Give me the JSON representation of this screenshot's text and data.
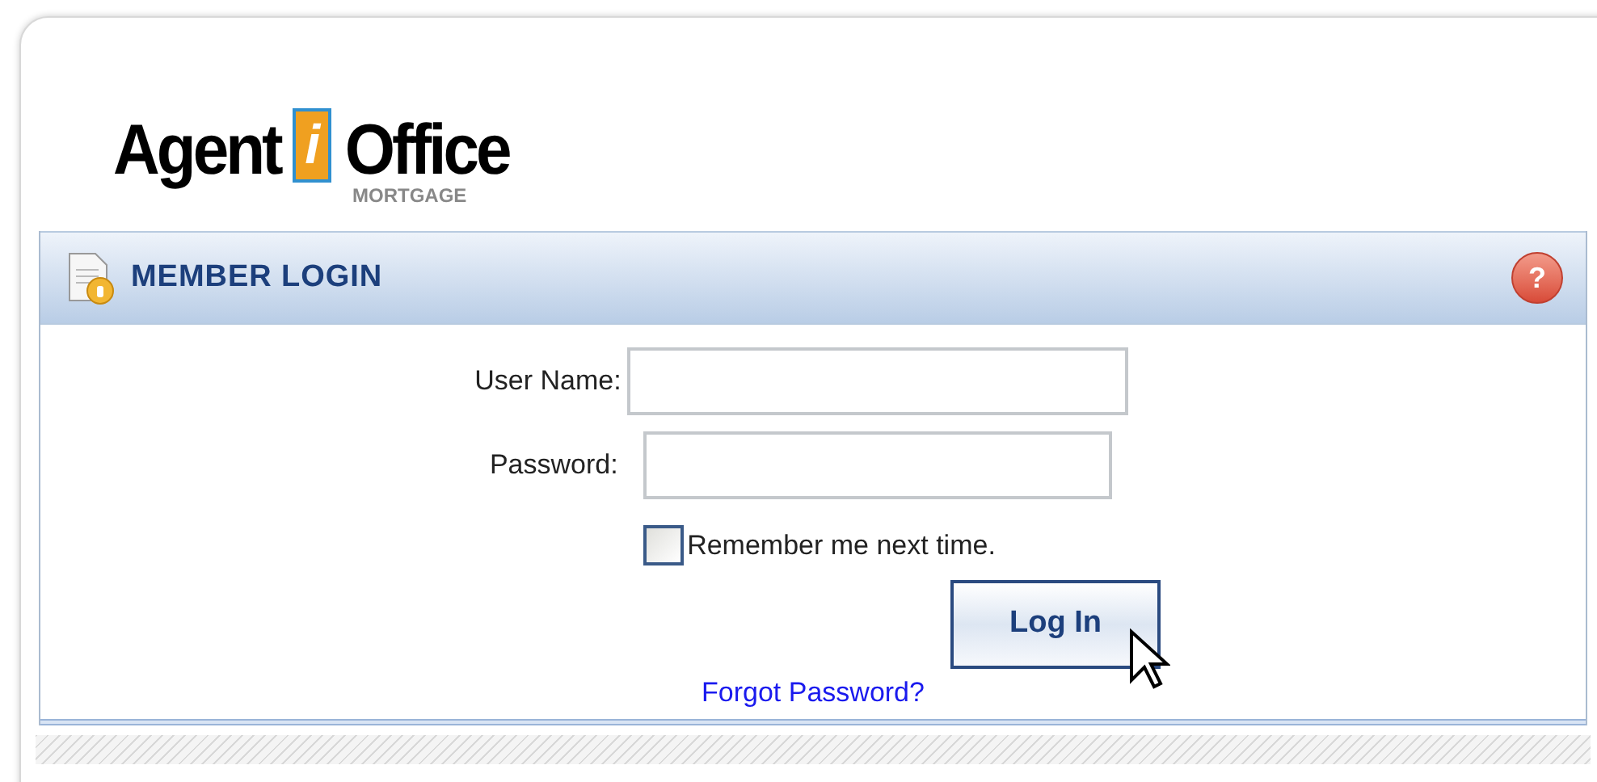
{
  "logo": {
    "word_1": "Agent",
    "letter": "i",
    "word_2": "Office",
    "subtitle": "MORTGAGE"
  },
  "panel": {
    "title": "MEMBER LOGIN",
    "help": "?"
  },
  "fields": [
    {
      "label": "User Name:"
    },
    {
      "label": "Password:"
    }
  ],
  "remember": {
    "label": "Remember me next time.",
    "checked": false
  },
  "login_button": "Log In",
  "forgot_link": "Forgot Password?"
}
